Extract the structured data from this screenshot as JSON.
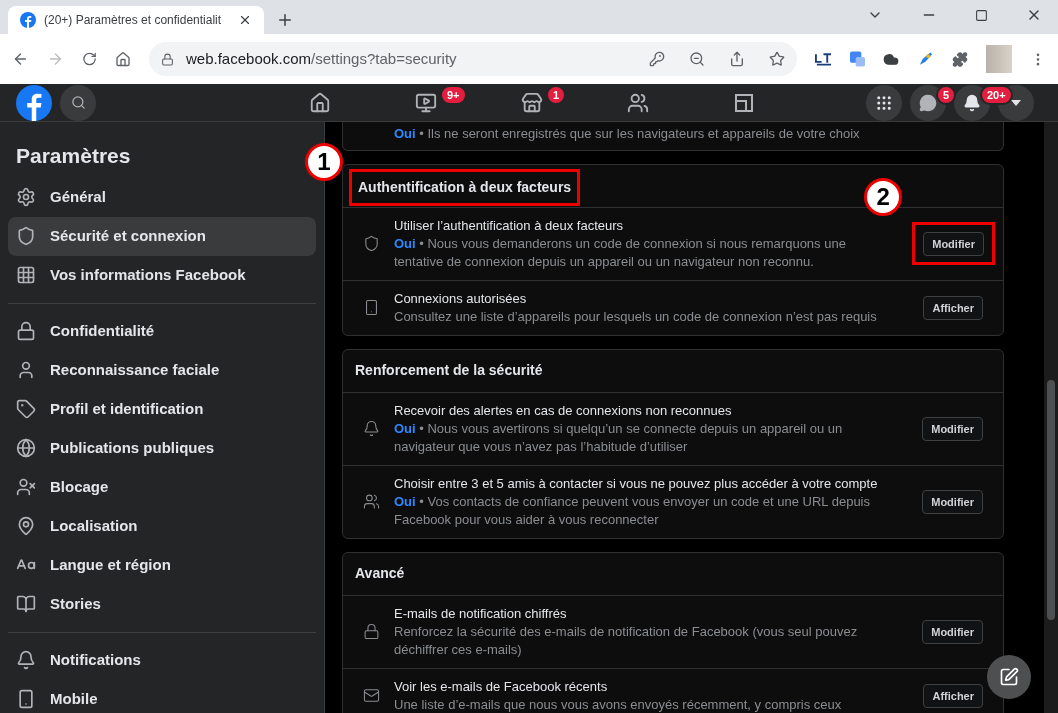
{
  "browser": {
    "tab_title": "(20+) Paramètres et confidentialit",
    "url_host": "web.facebook.com",
    "url_path": "/settings?tab=security"
  },
  "header": {
    "nav": [
      {
        "kind": "home",
        "selected": false
      },
      {
        "kind": "watch",
        "badge": "9+",
        "selected": false
      },
      {
        "kind": "marketplace",
        "badge": "1",
        "selected": false
      },
      {
        "kind": "groups",
        "selected": false
      },
      {
        "kind": "gaming",
        "selected": false
      }
    ],
    "actions": [
      {
        "kind": "menu"
      },
      {
        "kind": "messenger",
        "badge": "5"
      },
      {
        "kind": "notifications",
        "badge": "20+"
      },
      {
        "kind": "account"
      }
    ]
  },
  "sidebar": {
    "title": "Paramètres",
    "groups": [
      [
        {
          "kind": "gear",
          "label": "Général",
          "selected": false
        },
        {
          "kind": "shield",
          "label": "Sécurité et connexion",
          "selected": true
        },
        {
          "kind": "grid",
          "label": "Vos informations Facebook",
          "selected": false
        }
      ],
      [
        {
          "kind": "lock",
          "label": "Confidentialité",
          "selected": false
        },
        {
          "kind": "person",
          "label": "Reconnaissance faciale",
          "selected": false
        },
        {
          "kind": "tag",
          "label": "Profil et identification",
          "selected": false
        },
        {
          "kind": "globe",
          "label": "Publications publiques",
          "selected": false
        },
        {
          "kind": "block",
          "label": "Blocage",
          "selected": false
        },
        {
          "kind": "pin",
          "label": "Localisation",
          "selected": false
        },
        {
          "kind": "language",
          "label": "Langue et région",
          "selected": false
        },
        {
          "kind": "book",
          "label": "Stories",
          "selected": false
        }
      ],
      [
        {
          "kind": "bell",
          "label": "Notifications",
          "selected": false
        },
        {
          "kind": "phone",
          "label": "Mobile",
          "selected": false
        }
      ]
    ]
  },
  "top_fragment": {
    "status": "Oui",
    "description": "• Ils ne seront enregistrés que sur les navigateurs et appareils de votre choix"
  },
  "sections": [
    {
      "title": "Authentification à deux facteurs",
      "highlighted": true,
      "annotation": "1",
      "rows": [
        {
          "kind": "shield",
          "title": "Utiliser l’authentification à deux facteurs",
          "status": "Oui",
          "description": "• Nous vous demanderons un code de connexion si nous remarquons une tentative de connexion depuis un appareil ou un navigateur non reconnu.",
          "button": {
            "label": "Modifier",
            "highlighted": true,
            "annotation": "2"
          }
        },
        {
          "kind": "phone",
          "title": "Connexions autorisées",
          "description": "Consultez une liste d’appareils pour lesquels un code de connexion n’est pas requis",
          "button": {
            "label": "Afficher",
            "highlighted": false
          }
        }
      ]
    },
    {
      "title": "Renforcement de la sécurité",
      "highlighted": false,
      "rows": [
        {
          "kind": "bell",
          "title": "Recevoir des alertes en cas de connexions non reconnues",
          "status": "Oui",
          "description": "• Nous vous avertirons si quelqu’un se connecte depuis un appareil ou un navigateur que vous n’avez pas l’habitude d’utiliser",
          "button": {
            "label": "Modifier",
            "highlighted": false
          }
        },
        {
          "kind": "people",
          "title": "Choisir entre 3 et 5 amis à contacter si vous ne pouvez plus accéder à votre compte",
          "status": "Oui",
          "description": "• Vos contacts de confiance peuvent vous envoyer un code et une URL depuis Facebook pour vous aider à vous reconnecter",
          "button": {
            "label": "Modifier",
            "highlighted": false
          }
        }
      ]
    },
    {
      "title": "Avancé",
      "highlighted": false,
      "rows": [
        {
          "kind": "lock",
          "title": "E-mails de notification chiffrés",
          "description": "Renforcez la sécurité des e-mails de notification de Facebook (vous seul pouvez déchiffrer ces e-mails)",
          "button": {
            "label": "Modifier",
            "highlighted": false
          }
        },
        {
          "kind": "mail",
          "title": "Voir les e-mails de Facebook récents",
          "description": "Une liste d’e-mails que nous vous avons envoyés récemment, y compris ceux",
          "button": {
            "label": "Afficher",
            "highlighted": false
          }
        }
      ]
    }
  ]
}
